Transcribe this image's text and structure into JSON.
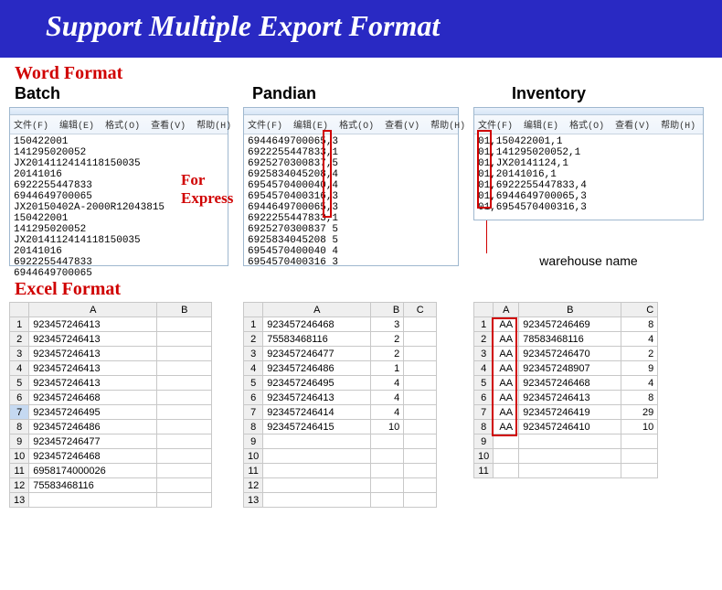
{
  "header": {
    "title": "Support Multiple Export Format"
  },
  "sections": {
    "word": "Word Format",
    "excel": "Excel Format",
    "batch": "Batch",
    "pandian": "Pandian",
    "inventory": "Inventory",
    "for_express": "For\nExpress",
    "warehouse": "warehouse name"
  },
  "menu": {
    "file": "文件(F)",
    "edit": "编辑(E)",
    "format": "格式(O)",
    "view": "查看(V)",
    "help": "帮助(H)"
  },
  "notepad": {
    "batch": "150422001\n141295020052\nJX2014112414118150035\n20141016\n6922255447833\n6944649700065\nJX20150402A-2000R12043815\n150422001\n141295020052\nJX2014112414118150035\n20141016\n6922255447833\n6944649700065",
    "pandian": "6944649700065,3\n6922255447833,1\n6925270300837,5\n6925834045208,4\n6954570400040,4\n6954570400316,3\n6944649700065,3\n6922255447833,1\n6925270300837 5\n6925834045208 5\n6954570400040 4\n6954570400316 3",
    "inventory": "01,150422001,1\n01,141295020052,1\n01,JX20141124,1\n01,20141016,1\n01,6922255447833,4\n01,6944649700065,3\n01,6954570400316,3"
  },
  "excel": {
    "headers": {
      "A": "A",
      "B": "B",
      "C": "C"
    },
    "batch": [
      {
        "n": 1,
        "a": "923457246413"
      },
      {
        "n": 2,
        "a": "923457246413"
      },
      {
        "n": 3,
        "a": "923457246413"
      },
      {
        "n": 4,
        "a": "923457246413"
      },
      {
        "n": 5,
        "a": "923457246413"
      },
      {
        "n": 6,
        "a": "923457246468"
      },
      {
        "n": 7,
        "a": "923457246495",
        "sel": true
      },
      {
        "n": 8,
        "a": "923457246486"
      },
      {
        "n": 9,
        "a": "923457246477"
      },
      {
        "n": 10,
        "a": "923457246468"
      },
      {
        "n": 11,
        "a": "6958174000026"
      },
      {
        "n": 12,
        "a": "75583468116"
      },
      {
        "n": 13,
        "a": ""
      }
    ],
    "pandian": [
      {
        "n": 1,
        "a": "923457246468",
        "b": "3"
      },
      {
        "n": 2,
        "a": "75583468116",
        "b": "2"
      },
      {
        "n": 3,
        "a": "923457246477",
        "b": "2"
      },
      {
        "n": 4,
        "a": "923457246486",
        "b": "1"
      },
      {
        "n": 5,
        "a": "923457246495",
        "b": "4"
      },
      {
        "n": 6,
        "a": "923457246413",
        "b": "4"
      },
      {
        "n": 7,
        "a": "923457246414",
        "b": "4"
      },
      {
        "n": 8,
        "a": "923457246415",
        "b": "10"
      },
      {
        "n": 9,
        "a": "",
        "b": ""
      },
      {
        "n": 10,
        "a": "",
        "b": ""
      },
      {
        "n": 11,
        "a": "",
        "b": ""
      },
      {
        "n": 12,
        "a": "",
        "b": ""
      },
      {
        "n": 13,
        "a": "",
        "b": ""
      }
    ],
    "inventory": [
      {
        "n": 1,
        "a": "AA",
        "b": "923457246469",
        "c": "8"
      },
      {
        "n": 2,
        "a": "AA",
        "b": "78583468116",
        "c": "4"
      },
      {
        "n": 3,
        "a": "AA",
        "b": "923457246470",
        "c": "2"
      },
      {
        "n": 4,
        "a": "AA",
        "b": "923457248907",
        "c": "9"
      },
      {
        "n": 5,
        "a": "AA",
        "b": "923457246468",
        "c": "4"
      },
      {
        "n": 6,
        "a": "AA",
        "b": "923457246413",
        "c": "8"
      },
      {
        "n": 7,
        "a": "AA",
        "b": "923457246419",
        "c": "29"
      },
      {
        "n": 8,
        "a": "AA",
        "b": "923457246410",
        "c": "10"
      },
      {
        "n": 9,
        "a": "",
        "b": "",
        "c": ""
      },
      {
        "n": 10,
        "a": "",
        "b": "",
        "c": ""
      },
      {
        "n": 11,
        "a": "",
        "b": "",
        "c": ""
      }
    ]
  }
}
